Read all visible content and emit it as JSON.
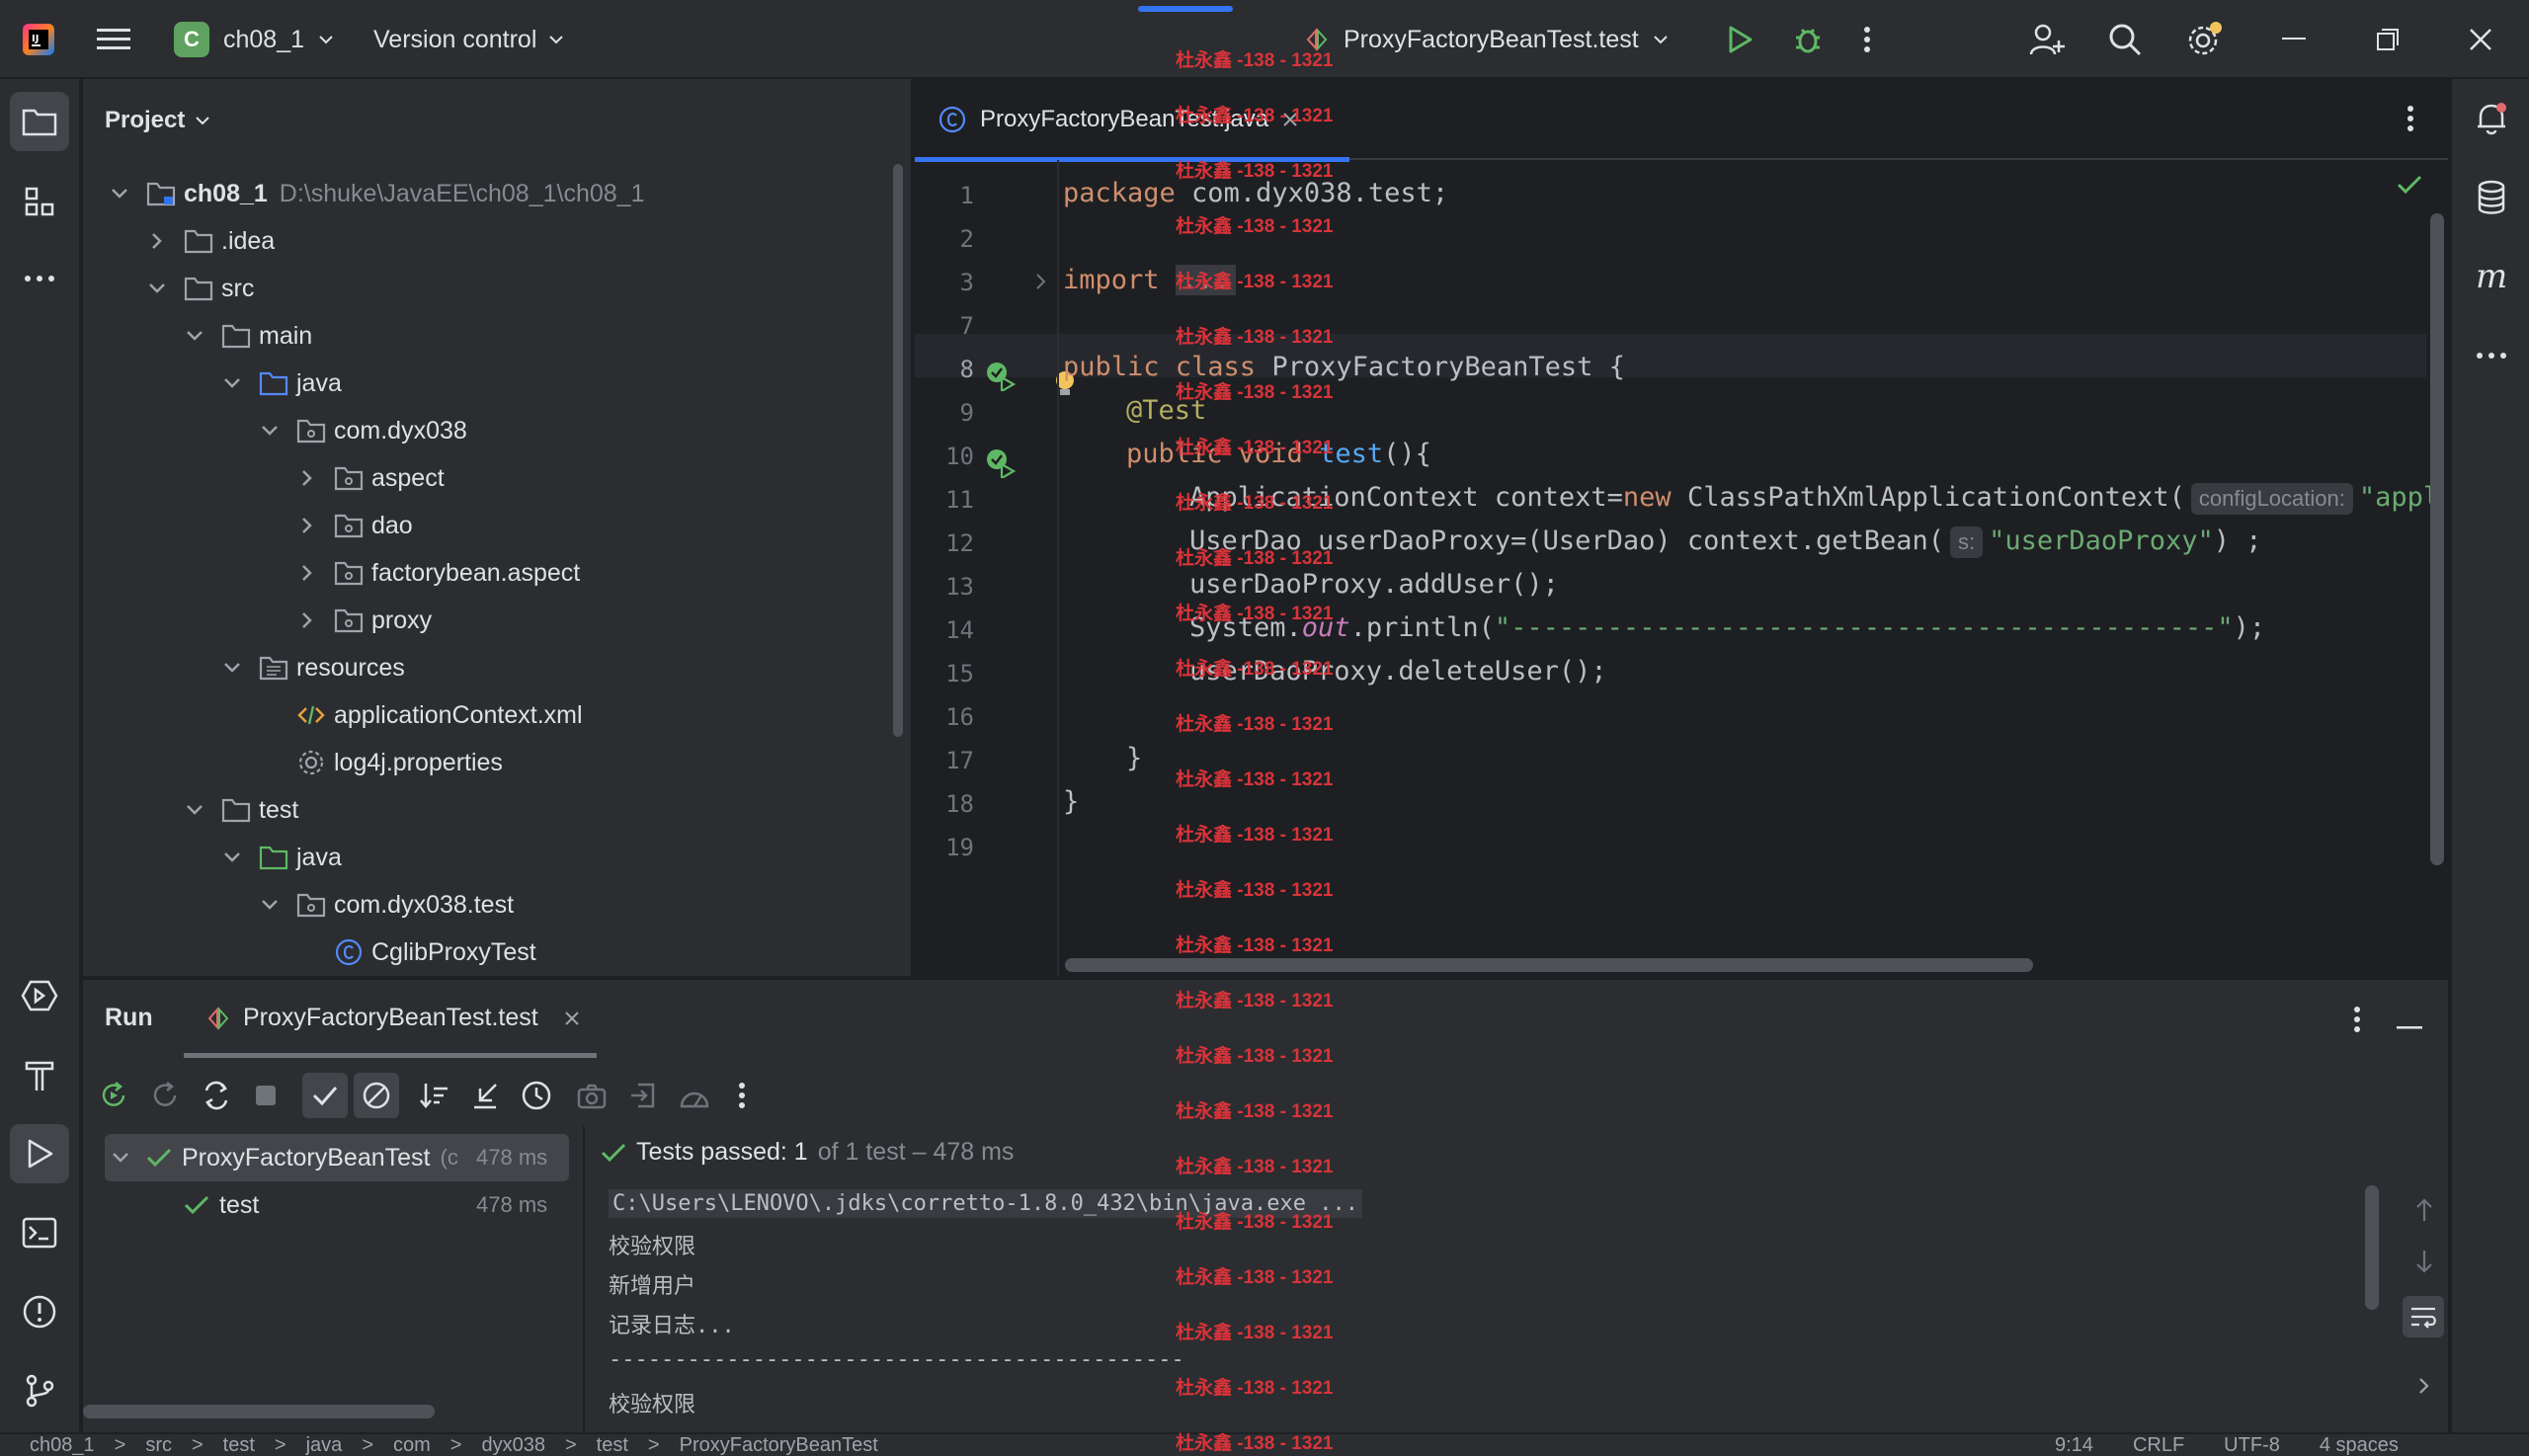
{
  "titlebar": {
    "project_badge": "C",
    "project_name": "ch08_1",
    "vcs": "Version control",
    "run_config": "ProxyFactoryBeanTest.test"
  },
  "project_panel": {
    "title": "Project",
    "tree": [
      {
        "label": "ch08_1",
        "path": "D:\\shuke\\JavaEE\\ch08_1\\ch08_1"
      },
      {
        "label": ".idea"
      },
      {
        "label": "src"
      },
      {
        "label": "main"
      },
      {
        "label": "java"
      },
      {
        "label": "com.dyx038"
      },
      {
        "label": "aspect"
      },
      {
        "label": "dao"
      },
      {
        "label": "factorybean.aspect"
      },
      {
        "label": "proxy"
      },
      {
        "label": "resources"
      },
      {
        "label": "applicationContext.xml"
      },
      {
        "label": "log4j.properties"
      },
      {
        "label": "test"
      },
      {
        "label": "java"
      },
      {
        "label": "com.dyx038.test"
      },
      {
        "label": "CglibProxyTest"
      }
    ]
  },
  "editor": {
    "tab_label": "ProxyFactoryBeanTest.java",
    "line_numbers": [
      "1",
      "2",
      "3",
      "7",
      "8",
      "9",
      "10",
      "11",
      "12",
      "13",
      "14",
      "15",
      "16",
      "17",
      "18",
      "19"
    ],
    "code": {
      "l1_kw": "package",
      "l1_rest": " com.dyx038.test;",
      "l3_kw": "import",
      "l3_fold": "...",
      "l8_kw": "public class",
      "l8_rest": " ProxyFactoryBeanTest {",
      "l9_ann": "@Test",
      "l10_kw": "public void",
      "l10_fn": "test",
      "l10_rest": "(){",
      "l11_a": "ApplicationContext context=",
      "l11_kw": "new",
      "l11_b": " ClassPathXmlApplicationContext(",
      "l11_hint": "configLocation:",
      "l11_str": "\"appl",
      "l12_a": "UserDao userDaoProxy=(UserDao) context.getBean(",
      "l12_hint": "s:",
      "l12_str": "\"userDaoProxy\"",
      "l12_b": ") ;",
      "l13": "userDaoProxy.addUser();",
      "l14_a": "System.",
      "l14_it": "out",
      "l14_b": ".println(",
      "l14_str": "\"--------------------------------------------\"",
      "l14_c": ");",
      "l15": "userDaoProxy.deleteUser();",
      "l17": "}",
      "l18": "}"
    }
  },
  "run_panel": {
    "title": "Run",
    "tab_label": "ProxyFactoryBeanTest.test",
    "tests": [
      {
        "label": "ProxyFactoryBeanTest",
        "suffix": "(c",
        "time": "478 ms"
      },
      {
        "label": "test",
        "time": "478 ms"
      }
    ],
    "status_bold": "Tests passed: 1",
    "status_rest": "of 1 test – 478 ms",
    "output": [
      "C:\\Users\\LENOVO\\.jdks\\corretto-1.8.0_432\\bin\\java.exe ...",
      "校验权限",
      "新增用户",
      "记录日志...",
      "--------------------------------------------",
      "校验权限"
    ]
  },
  "statusbar": {
    "crumbs": [
      "ch08_1",
      ">",
      "src",
      ">",
      "test",
      ">",
      "java",
      ">",
      "com",
      ">",
      "dyx038",
      ">",
      "test",
      ">",
      "ProxyFactoryBeanTest"
    ],
    "position": "9:14",
    "line_sep": "CRLF",
    "encoding": "UTF-8",
    "indent": "4 spaces"
  },
  "watermark": "杜永鑫 -138 - 1321",
  "colors": {
    "accent": "#3574f0",
    "success": "#5fb865",
    "watermark": "#d8343a"
  }
}
